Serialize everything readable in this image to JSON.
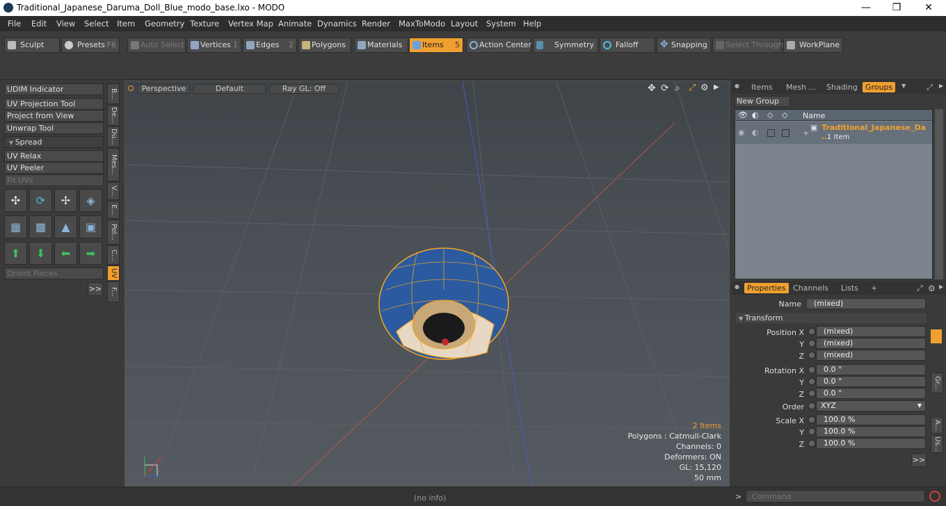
{
  "window": {
    "title": "Traditional_Japanese_Daruma_Doll_Blue_modo_base.lxo - MODO",
    "minimize": "—",
    "maximize": "❐",
    "close": "✕"
  },
  "menu": [
    "File",
    "Edit",
    "View",
    "Select",
    "Item",
    "Geometry",
    "Texture",
    "Vertex Map",
    "Animate",
    "Dynamics",
    "Render",
    "MaxToModo",
    "Layout",
    "System",
    "Help"
  ],
  "toolbar": {
    "sculpt": "Sculpt",
    "presets": "Presets",
    "presets_key": "F6",
    "auto_select": "Auto Select",
    "vertices": "Vertices",
    "vertices_num": "1",
    "edges": "Edges",
    "edges_num": "2",
    "polygons": "Polygons",
    "materials": "Materials",
    "items": "Items",
    "items_num": "5",
    "action_center": "Action Center",
    "symmetry": "Symmetry",
    "falloff": "Falloff",
    "snapping": "Snapping",
    "select_through": "Select Through",
    "workplane": "WorkPlane"
  },
  "left": {
    "udim": "UDIM Indicator",
    "uv_projection": "UV Projection Tool",
    "project_view": "Project from View",
    "unwrap": "Unwrap Tool",
    "spread": "Spread",
    "uv_relax": "UV Relax",
    "uv_peeler": "UV Peeler",
    "fit_uvs": "Fit UVs",
    "orient": "Orient Pieces",
    "more": ">>",
    "vtabs": [
      "B...",
      "De...",
      "Du...",
      "Mes...",
      "V...",
      "E...",
      "Pol...",
      "C...",
      "UV",
      "F..."
    ]
  },
  "viewport": {
    "perspective": "Perspective",
    "default": "Default",
    "raygl": "Ray GL: Off",
    "items_count": "2 Items",
    "polygons": "Polygons : Catmull-Clark",
    "channels": "Channels: 0",
    "deformers": "Deformers: ON",
    "gl": "GL: 15,120",
    "focal": "50 mm"
  },
  "groups": {
    "tabs": [
      "Items",
      "Mesh ...",
      "Shading",
      "Groups"
    ],
    "new_group": "New Group",
    "name_header": "Name",
    "item_name": "Traditional_Japanese_Da ...",
    "item_count": "1 Item"
  },
  "properties": {
    "tabs": [
      "Properties",
      "Channels",
      "Lists"
    ],
    "add_tab": "+",
    "name_label": "Name",
    "name_value": "(mixed)",
    "transform": "Transform",
    "position_x_label": "Position X",
    "y_label": "Y",
    "z_label": "Z",
    "pos_x": "(mixed)",
    "pos_y": "(mixed)",
    "pos_z": "(mixed)",
    "rotation_x_label": "Rotation X",
    "rot_x": "0.0 °",
    "rot_y": "0.0 °",
    "rot_z": "0.0 °",
    "order_label": "Order",
    "order_value": "XYZ",
    "scale_x_label": "Scale X",
    "scale_x": "100.0 %",
    "scale_y": "100.0 %",
    "scale_z": "100.0 %",
    "more": ">>",
    "side_tabs": [
      "Gr...",
      "A...",
      "Us..."
    ]
  },
  "status": {
    "info": "(no info)",
    "command_prompt": ">",
    "command_placeholder": "Command"
  }
}
